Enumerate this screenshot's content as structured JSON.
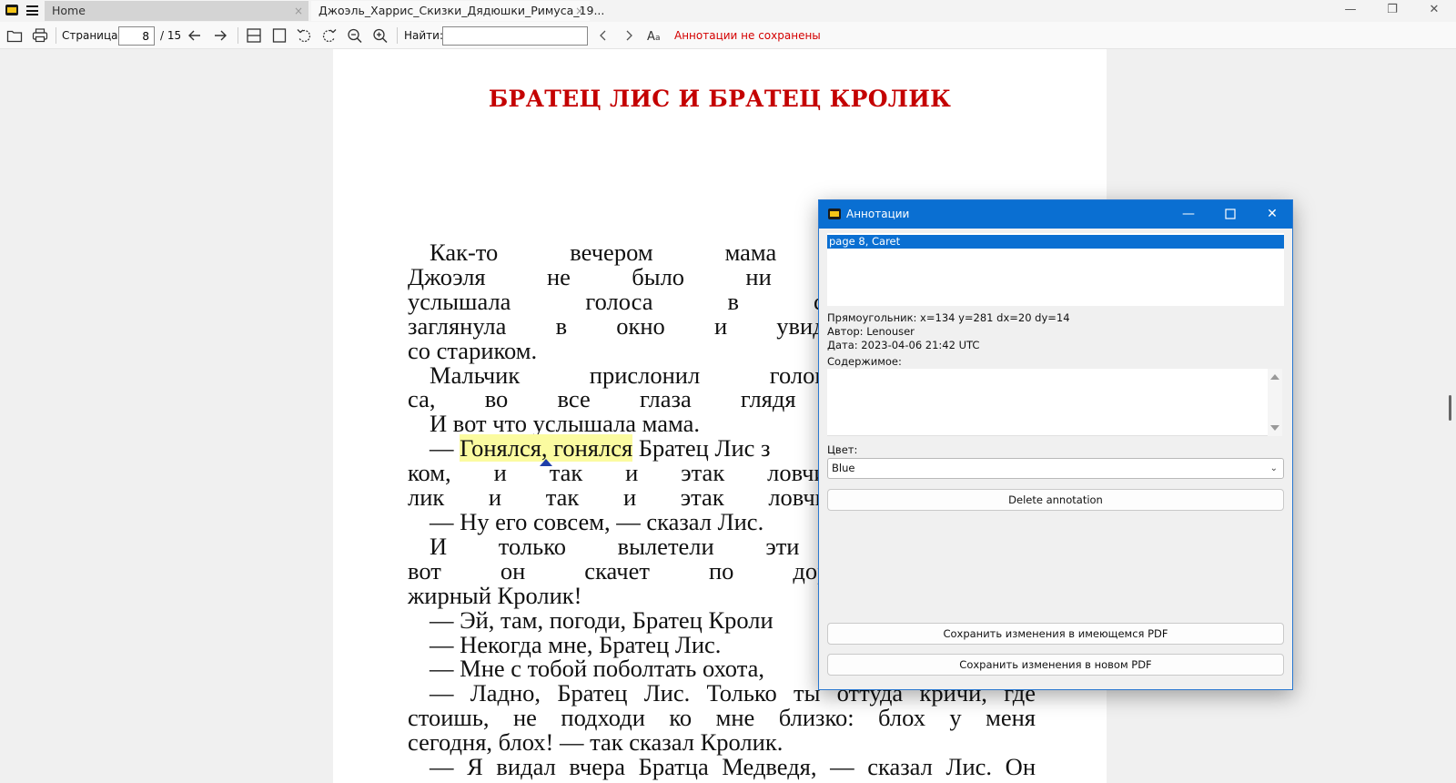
{
  "tabs": {
    "home": "Home",
    "document": "Джоэль_Харрис_Скизки_Дядюшки_Римуса_19...",
    "close": "×"
  },
  "window_controls": {
    "minimize": "—",
    "restore": "❐",
    "close": "✕"
  },
  "toolbar": {
    "page_label": "Страница:",
    "page_value": "8",
    "page_total": "/ 15",
    "find_label": "Найти:",
    "find_value": "",
    "warning": "Аннотации не сохранены",
    "colors": {
      "warning": "#d40000"
    }
  },
  "document": {
    "title": "БРАТЕЦ ЛИС И БРАТЕЦ КРОЛИК",
    "title_color": "#c40000",
    "highlight_text": "Гонялся, гонялся",
    "highlight_color": "#fbfba0",
    "lines": {
      "l1": "Как-то вечером мама долго искал",
      "l2": "Джоэля не было ни в доме, н",
      "l3": "услышала голоса в старой хижине",
      "l4": "заглянула в окно и увидела, что мал",
      "l5": "со стариком.",
      "l6": "Мальчик прислонил голову к плеч",
      "l7": "са, во все глаза глядя в морщинисто",
      "l8": "И вот что услышала мама.",
      "l9_pre": "— ",
      "l9_post": " Братец Лис з",
      "l10": "ком, и так и этак ловчился, чтобы ег",
      "l11": "лик и так и этак ловчился, чтобы Л",
      "l12": "— Ну его совсем, — сказал Лис.",
      "l13": "И только вылетели эти слова у н",
      "l14": "вот он скачет по дороге — гла",
      "l15": "жирный Кролик!",
      "l16": "— Эй, там, погоди, Братец Кроли",
      "l17": "— Некогда мне, Братец Лис.",
      "l18": "— Мне с тобой поболтать охота,",
      "l19": "— Ладно, Братец Лис. Только ты оттуда кричи, где",
      "l20": "стоишь, не подходи ко мне близко: блох у меня",
      "l21": "сегодня, блох! — так сказал Кролик.",
      "l22": "— Я видал вчера Братца Медведя, — сказал Лис. Он"
    }
  },
  "dialog": {
    "title": "Аннотации",
    "list_item": "page 8, Caret",
    "rect_line": "Прямоугольник: x=134 y=281 dx=20 dy=14",
    "author_line": "Автор: Lenouser",
    "date_line": "Дата: 2023-04-06 21:42 UTC",
    "contents_label": "Содержимое:",
    "contents_value": "",
    "color_label": "Цвет:",
    "color_value": "Blue",
    "delete_button": "Delete annotation",
    "save_existing_button": "Сохранить изменения в имеющемся PDF",
    "save_new_button": "Сохранить изменения в новом PDF",
    "accent_color": "#0a6fd2",
    "icons": [
      "app-logo-icon",
      "menu-icon",
      "open-folder-icon",
      "print-icon",
      "prev-page-icon",
      "next-page-icon",
      "continuous-view-icon",
      "single-page-icon",
      "rotate-left-icon",
      "rotate-right-icon",
      "zoom-out-icon",
      "zoom-in-icon",
      "find-prev-icon",
      "find-next-icon",
      "match-case-icon"
    ]
  }
}
